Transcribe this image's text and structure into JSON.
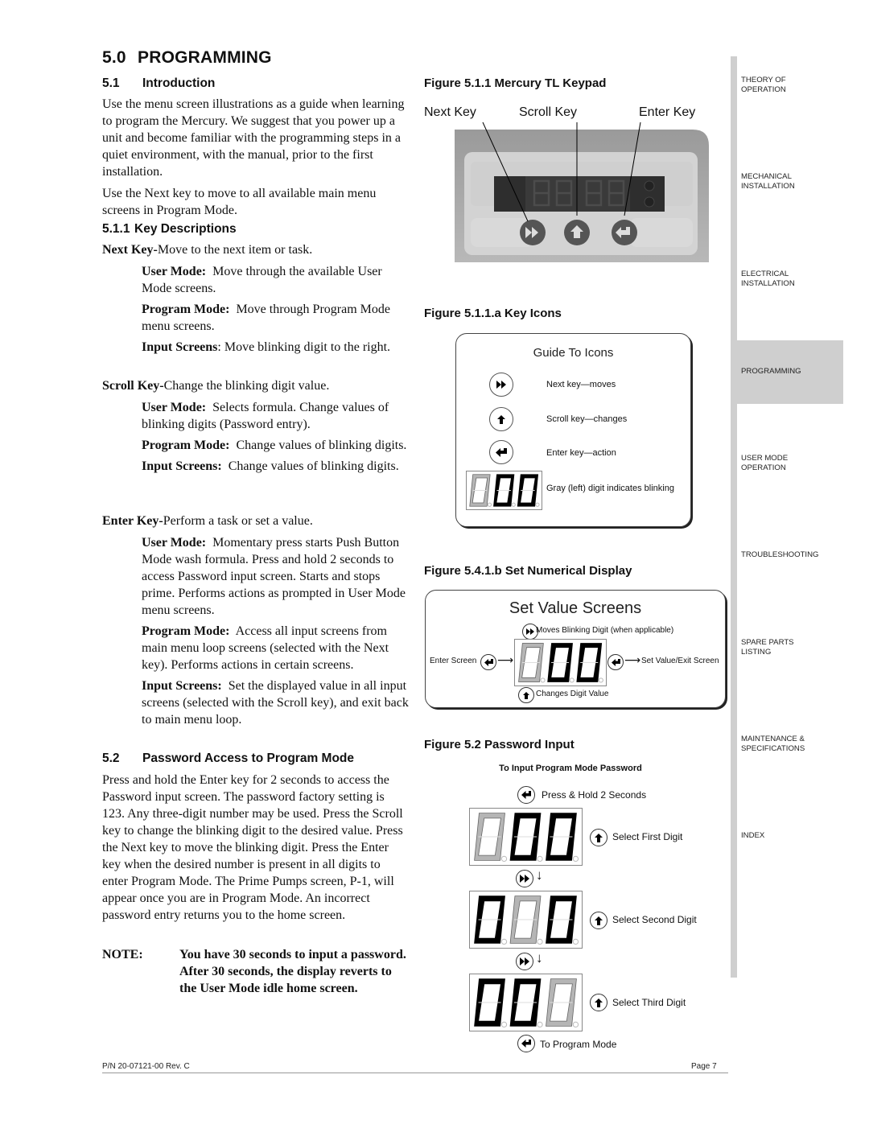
{
  "section": {
    "number": "5.0",
    "title": "PROGRAMMING"
  },
  "intro": {
    "number": "5.1",
    "title": "Introduction",
    "p1": "Use the menu screen illustrations as a guide when learning to program the Mercury. We suggest that you power up a unit and become familiar with the programming steps in a quiet environment, with the manual, prior to the first installation.",
    "p2": "Use the Next key to move to all available main menu screens in Program Mode."
  },
  "key_desc": {
    "number": "5.1.1",
    "title": "Key Descriptions",
    "keys": [
      {
        "name": "Next Key-",
        "desc": "Move to the next item or task.",
        "modes": [
          {
            "label": "User Mode:",
            "text": "Move through the available User Mode screens."
          },
          {
            "label": "Program Mode:",
            "text": "Move through Program Mode menu screens."
          },
          {
            "label": "Input Screens",
            "text": ":  Move blinking digit to the right."
          }
        ]
      },
      {
        "name": "Scroll Key-",
        "desc": "Change the blinking digit value.",
        "modes": [
          {
            "label": "User Mode:",
            "text": "Selects formula. Change values of blinking digits (Password entry)."
          },
          {
            "label": "Program Mode:",
            "text": "Change values of blinking digits."
          },
          {
            "label": "Input Screens:",
            "text": "Change values of blinking digits."
          }
        ]
      },
      {
        "name": "Enter Key-",
        "desc": "Perform a task or set a value.",
        "modes": [
          {
            "label": "User Mode:",
            "text": "Momentary press starts Push Button Mode wash formula. Press and hold 2 seconds to access Password input screen. Starts and stops prime. Performs actions as prompted in User Mode menu screens."
          },
          {
            "label": "Program Mode:",
            "text": "Access all input screens from main menu loop screens (selected with the Next key). Performs actions in certain screens."
          },
          {
            "label": "Input Screens:",
            "text": "Set the displayed value in all input screens (selected with the Scroll key), and exit back to main menu loop."
          }
        ]
      }
    ]
  },
  "password": {
    "number": "5.2",
    "title": "Password Access to Program Mode",
    "body": "Press and hold the Enter key for 2 seconds to access the Password input screen. The password factory setting is 123. Any three-digit number may be used. Press the Scroll key to change the blinking digit to the desired value. Press the Next key to move the blinking digit. Press the Enter key when the desired number is present in all digits to enter Program Mode. The Prime Pumps screen, P-1, will appear once you are in Program Mode. An incorrect password entry returns you to the home screen.",
    "note_label": "NOTE:",
    "note_text": "You have 30 seconds to input a password. After 30 seconds, the display reverts to the User Mode idle home screen."
  },
  "figures": {
    "keypad": {
      "title": "Figure 5.1.1 Mercury TL Keypad",
      "labels": [
        "Next Key",
        "Scroll Key",
        "Enter Key"
      ]
    },
    "key_icons": {
      "title": "Figure 5.1.1.a   Key Icons",
      "box_title": "Guide To Icons",
      "items": [
        {
          "icon": "next-icon",
          "text": "Next key—moves"
        },
        {
          "icon": "scroll-icon",
          "text": "Scroll key—changes"
        },
        {
          "icon": "enter-icon",
          "text": "Enter key—action"
        }
      ],
      "display_caption": "Gray (left) digit indicates blinking",
      "display_digits": [
        "0",
        "0",
        "0"
      ],
      "blinking_index": 0
    },
    "set_numerical": {
      "title": "Figure 5.4.1.b Set Numerical Display",
      "box_title": "Set Value Screens",
      "top_caption": "Moves Blinking Digit (when applicable)",
      "left_caption": "Enter Screen",
      "right_caption": "Set Value/Exit Screen",
      "bottom_caption": "Changes Digit Value",
      "display_digits": [
        "0",
        "0",
        "0"
      ],
      "blinking_index": 0
    },
    "password_input": {
      "title": "Figure 5.2 Password Input",
      "subtitle": "To Input Program Mode Password",
      "start_caption": "Press & Hold 2 Seconds",
      "steps": [
        {
          "caption": "Select First Digit",
          "blinking_index": 0
        },
        {
          "caption": "Select Second Digit",
          "blinking_index": 1
        },
        {
          "caption": "Select Third Digit",
          "blinking_index": 2
        }
      ],
      "end_caption": "To Program Mode"
    }
  },
  "side_tabs": [
    {
      "label": "THEORY OF\nOPERATION",
      "active": false
    },
    {
      "label": "MECHANICAL\nINSTALLATION",
      "active": false
    },
    {
      "label": "ELECTRICAL\nINSTALLATION",
      "active": false
    },
    {
      "label": "PROGRAMMING",
      "active": true
    },
    {
      "label": "USER MODE\nOPERATION",
      "active": false
    },
    {
      "label": "TROUBLESHOOTING",
      "active": false
    },
    {
      "label": "SPARE PARTS\nLISTING",
      "active": false
    },
    {
      "label": "MAINTENANCE &\nSPECIFICATIONS",
      "active": false
    },
    {
      "label": "INDEX",
      "active": false
    }
  ],
  "footer": {
    "part_number": "P/N 20-07121-00 Rev. C",
    "page": "Page 7"
  }
}
